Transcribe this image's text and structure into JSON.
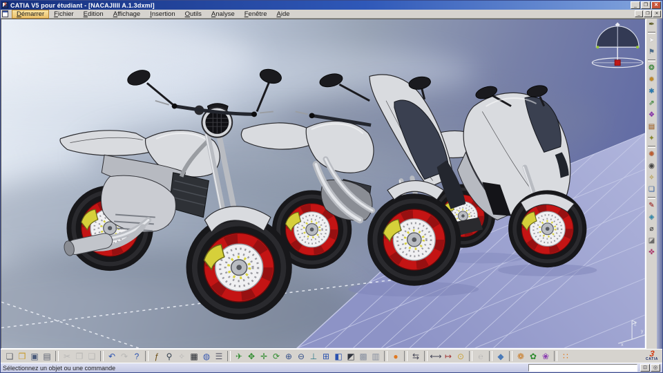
{
  "colors": {
    "title1": "#16307e",
    "title2": "#2f58b8",
    "title3": "#84a6de",
    "chromeUI": "#d6d3ce",
    "accentMenu": "#edc26a",
    "tire": "#17171a",
    "rim": "#c41414",
    "rimDark": "#8f0f10",
    "disc": "#f0f0f2",
    "dot": "#9a9aa0",
    "caliper": "#d6d03a",
    "body": "#d9dbdf",
    "bodyShade": "#b7bac1",
    "edge": "#2a2a2e",
    "chrome": "#b9bcc2",
    "chromeHl": "#e4e6ea",
    "glass": "#3a4050",
    "ground": "#9aa0ce",
    "grid": "#c6cae8"
  },
  "window": {
    "title": "CATIA V5 pour étudiant - [NACAJIIII A.1.3dxml]",
    "controls": [
      {
        "name": "minimize-button",
        "glyph": "_"
      },
      {
        "name": "restore-button",
        "glyph": "❐"
      },
      {
        "name": "close-button",
        "glyph": "✕",
        "cls": "close"
      }
    ]
  },
  "menu": {
    "items": [
      {
        "name": "menu-demarrer",
        "label": "Démarrer",
        "cls": "start"
      },
      {
        "name": "menu-fichier",
        "label": "Fichier"
      },
      {
        "name": "menu-edition",
        "label": "Edition"
      },
      {
        "name": "menu-affichage",
        "label": "Affichage"
      },
      {
        "name": "menu-insertion",
        "label": "Insertion"
      },
      {
        "name": "menu-outils",
        "label": "Outils"
      },
      {
        "name": "menu-analyse",
        "label": "Analyse"
      },
      {
        "name": "menu-fenetre",
        "label": "Fenêtre"
      },
      {
        "name": "menu-aide",
        "label": "Aide"
      }
    ],
    "child_controls": [
      {
        "name": "child-minimize-button",
        "glyph": "_"
      },
      {
        "name": "child-restore-button",
        "glyph": "❐"
      },
      {
        "name": "child-close-button",
        "glyph": "✕"
      }
    ]
  },
  "toolbars": {
    "right": [
      {
        "name": "analysis-pen-icon",
        "glyph": "✒",
        "color": "#5a5a20"
      },
      {
        "name": "separator",
        "cls": "sep"
      },
      {
        "name": "select-icon",
        "glyph": "➤",
        "color": "#f4f4f6"
      },
      {
        "name": "fly-cursor-icon",
        "glyph": "⚑",
        "color": "#4a6a8a"
      },
      {
        "name": "separator",
        "cls": "sep"
      },
      {
        "name": "workbench-sketch-icon",
        "glyph": "❂",
        "color": "#2e8b2e"
      },
      {
        "name": "workbench-part-icon",
        "glyph": "✹",
        "color": "#c08a2a"
      },
      {
        "name": "workbench-shape-icon",
        "glyph": "✱",
        "color": "#2a7ab0"
      },
      {
        "name": "exit-workbench-icon",
        "glyph": "⇗",
        "color": "#2e8b2e"
      },
      {
        "name": "paste-special-icon",
        "glyph": "❖",
        "color": "#8a2ab0"
      },
      {
        "name": "catalog-icon",
        "glyph": "▤",
        "color": "#b06a2a"
      },
      {
        "name": "photo-icon",
        "glyph": "✦",
        "color": "#8a8a2a"
      },
      {
        "name": "separator",
        "cls": "sep"
      },
      {
        "name": "render-icon",
        "glyph": "✺",
        "color": "#c05a2a"
      },
      {
        "name": "camera-icon",
        "glyph": "◉",
        "color": "#444444"
      },
      {
        "name": "light-icon",
        "glyph": "✧",
        "color": "#caa52a"
      },
      {
        "name": "environment-icon",
        "glyph": "❏",
        "color": "#3a6ab0"
      },
      {
        "name": "separator",
        "cls": "sep"
      },
      {
        "name": "sketch-trace-icon",
        "glyph": "✎",
        "color": "#b02a2a"
      },
      {
        "name": "sticker-icon",
        "glyph": "◈",
        "color": "#2a8ab0"
      },
      {
        "name": "measure-icon",
        "glyph": "⌀",
        "color": "#444444"
      },
      {
        "name": "section-icon",
        "glyph": "◪",
        "color": "#6a6a6a"
      },
      {
        "name": "bookmark-icon",
        "glyph": "✜",
        "color": "#b02a6a"
      }
    ],
    "bottom": [
      {
        "name": "new-document-icon",
        "glyph": "❏",
        "color": "#60636b"
      },
      {
        "name": "open-icon",
        "glyph": "❒",
        "color": "#c89a2a"
      },
      {
        "name": "save-icon",
        "glyph": "▣",
        "color": "#4a5a7a"
      },
      {
        "name": "print-icon",
        "glyph": "▤",
        "color": "#5a6070"
      },
      {
        "name": "separator",
        "cls": "sep"
      },
      {
        "name": "cut-icon",
        "glyph": "✂",
        "color": "#9aa0a8",
        "cls": "dim"
      },
      {
        "name": "copy-icon",
        "glyph": "❐",
        "color": "#9aa0a8",
        "cls": "dim"
      },
      {
        "name": "paste-icon",
        "glyph": "❑",
        "color": "#9aa0a8",
        "cls": "dim"
      },
      {
        "name": "separator",
        "cls": "sep"
      },
      {
        "name": "undo-icon",
        "glyph": "↶",
        "color": "#2a52b0"
      },
      {
        "name": "redo-icon",
        "glyph": "↷",
        "color": "#9aa0a8",
        "cls": "dim"
      },
      {
        "name": "help-icon",
        "glyph": "?",
        "color": "#2a52b0"
      },
      {
        "name": "separator",
        "cls": "sep"
      },
      {
        "name": "fx-formula-icon",
        "glyph": "ƒ",
        "color": "#6a4a10"
      },
      {
        "name": "search-icon",
        "glyph": "⚲",
        "color": "#33404e"
      },
      {
        "name": "knowledge-icon",
        "glyph": "✧",
        "color": "#9aa0a8",
        "cls": "dim"
      },
      {
        "name": "design-table-icon",
        "glyph": "▦",
        "color": "#23262c"
      },
      {
        "name": "globe-icon",
        "glyph": "◍",
        "color": "#3a5ab0"
      },
      {
        "name": "rules-icon",
        "glyph": "☰",
        "color": "#555566"
      },
      {
        "name": "separator",
        "cls": "sep"
      },
      {
        "name": "fly-mode-icon",
        "glyph": "✈",
        "color": "#2e8b2e"
      },
      {
        "name": "fit-all-icon",
        "glyph": "✥",
        "color": "#2e8b2e"
      },
      {
        "name": "pan-icon",
        "glyph": "✛",
        "color": "#2e8b2e"
      },
      {
        "name": "rotate-icon",
        "glyph": "⟳",
        "color": "#2e8b2e"
      },
      {
        "name": "zoom-in-icon",
        "glyph": "⊕",
        "color": "#35508a"
      },
      {
        "name": "zoom-out-icon",
        "glyph": "⊖",
        "color": "#35508a"
      },
      {
        "name": "normal-view-icon",
        "glyph": "⊥",
        "color": "#2e7b8b"
      },
      {
        "name": "multi-view-icon",
        "glyph": "⊞",
        "color": "#2a52b0"
      },
      {
        "name": "iso-view-icon",
        "glyph": "◧",
        "color": "#2a52b0"
      },
      {
        "name": "shaded-view-icon",
        "glyph": "◩",
        "color": "#30343e"
      },
      {
        "name": "hidden-line-view-icon",
        "glyph": "▩",
        "color": "#8890a0"
      },
      {
        "name": "wireframe-view-icon",
        "glyph": "▥",
        "color": "#8890a0"
      },
      {
        "name": "separator",
        "cls": "sep"
      },
      {
        "name": "apply-material-icon",
        "glyph": "●",
        "color": "#e07820"
      },
      {
        "name": "separator",
        "cls": "sep"
      },
      {
        "name": "swap-visible-space-icon",
        "glyph": "⇆",
        "color": "#444455"
      },
      {
        "name": "separator",
        "cls": "sep"
      },
      {
        "name": "measure-between-icon",
        "glyph": "⟷",
        "color": "#444455"
      },
      {
        "name": "measure-item-icon",
        "glyph": "↦",
        "color": "#a03030"
      },
      {
        "name": "measure-inertia-icon",
        "glyph": "⊙",
        "color": "#c8a23a"
      },
      {
        "name": "separator",
        "cls": "sep"
      },
      {
        "name": "energy-icon",
        "glyph": "℮",
        "color": "#9aa0a8",
        "cls": "dim"
      },
      {
        "name": "separator",
        "cls": "sep"
      },
      {
        "name": "material-prism-icon",
        "glyph": "◆",
        "color": "#4a7ab8"
      },
      {
        "name": "separator",
        "cls": "sep"
      },
      {
        "name": "paint-icon",
        "glyph": "❁",
        "color": "#c87820"
      },
      {
        "name": "texture-icon",
        "glyph": "✿",
        "color": "#2e8b2e"
      },
      {
        "name": "decal-icon",
        "glyph": "❀",
        "color": "#8a3ab0"
      },
      {
        "name": "separator",
        "cls": "sep"
      },
      {
        "name": "grid-snap-icon",
        "glyph": "∷",
        "color": "#e07820"
      }
    ]
  },
  "viewport": {
    "axis_labels": {
      "x": "x",
      "y": "y",
      "z": "z"
    }
  },
  "logo": {
    "mark": "3",
    "text": "CATIA"
  },
  "statusbar": {
    "message": "Sélectionnez un objet ou une commande",
    "command_value": "",
    "buttons": [
      {
        "name": "command-history-button",
        "glyph": "⊡"
      },
      {
        "name": "power-input-button",
        "glyph": "◎"
      }
    ]
  }
}
